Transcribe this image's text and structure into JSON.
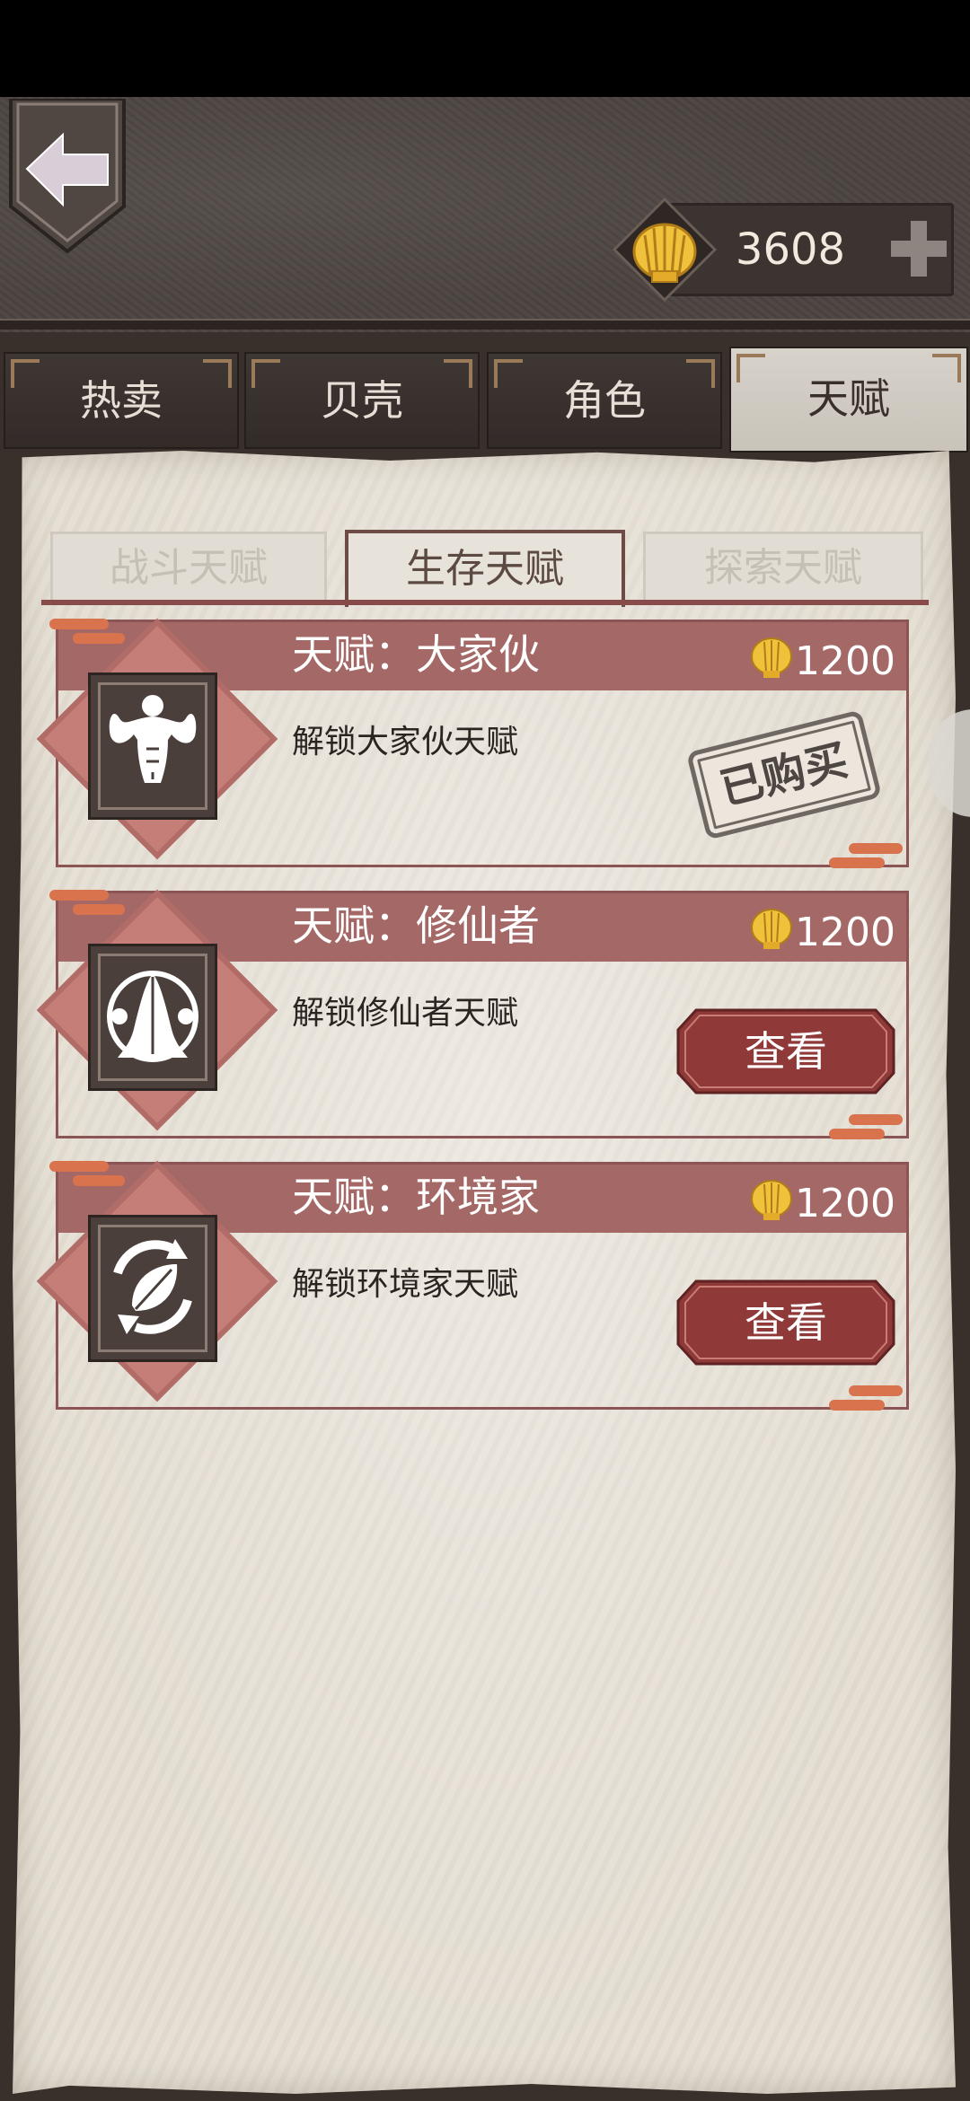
{
  "currency": {
    "amount": "3608"
  },
  "main_tabs": [
    {
      "label": "热卖",
      "active": false
    },
    {
      "label": "贝壳",
      "active": false
    },
    {
      "label": "角色",
      "active": false
    },
    {
      "label": "天赋",
      "active": true
    }
  ],
  "sub_tabs": [
    {
      "label": "战斗天赋",
      "active": false
    },
    {
      "label": "生存天赋",
      "active": true
    },
    {
      "label": "探索天赋",
      "active": false
    }
  ],
  "talents": [
    {
      "title": "天赋：大家伙",
      "price": "1200",
      "description": "解锁大家伙天赋",
      "action": "已购买",
      "purchased": true,
      "icon": "muscle-man-icon"
    },
    {
      "title": "天赋：修仙者",
      "price": "1200",
      "description": "解锁修仙者天赋",
      "action": "查看",
      "purchased": false,
      "icon": "praying-hands-icon"
    },
    {
      "title": "天赋：环境家",
      "price": "1200",
      "description": "解锁环境家天赋",
      "action": "查看",
      "purchased": false,
      "icon": "leaf-recycle-icon"
    }
  ],
  "colors": {
    "accent": "#a46967",
    "button": "#8f3a38",
    "parchment": "#e4ded3",
    "leather": "#4c4440"
  }
}
